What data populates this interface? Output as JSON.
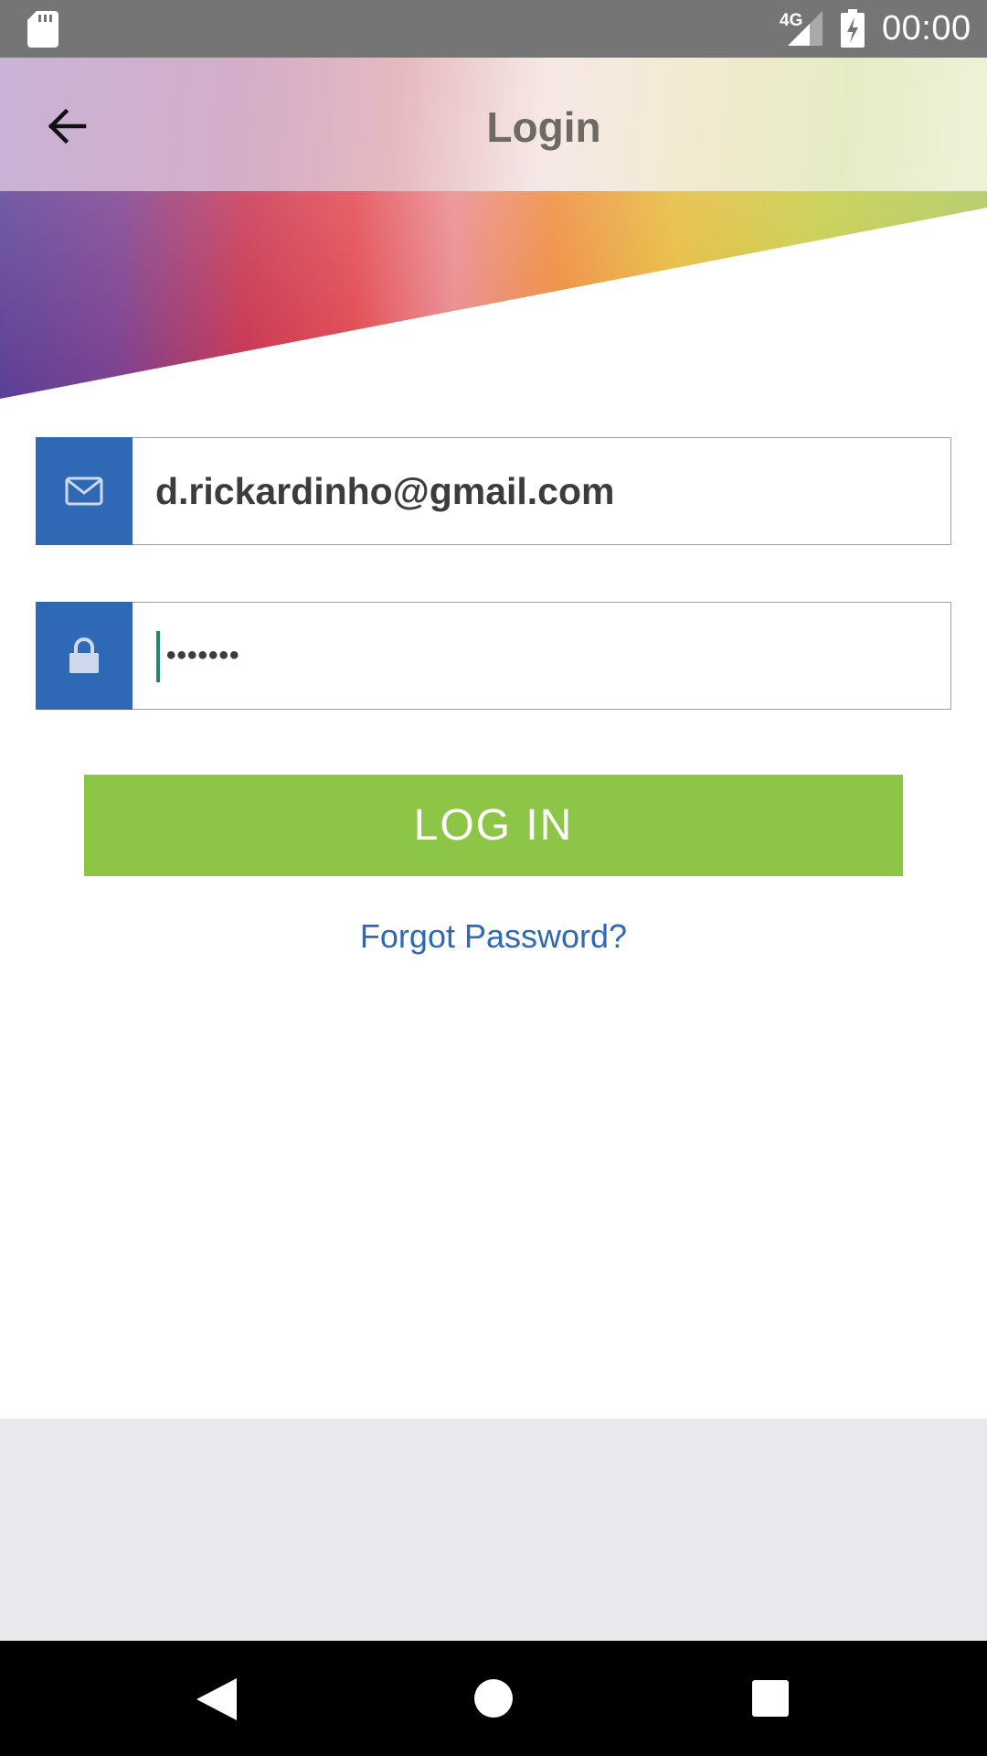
{
  "status_bar": {
    "network_label": "4G",
    "time": "00:00",
    "icons": [
      "sd-card-icon",
      "signal-icon",
      "battery-charging-icon"
    ]
  },
  "header": {
    "title": "Login",
    "back_icon": "arrow-back-icon"
  },
  "form": {
    "email": {
      "icon": "mail-icon",
      "value": "d.rickardinho@gmail.com"
    },
    "password": {
      "icon": "lock-icon",
      "value": "•••••••"
    },
    "login_label": "LOG IN",
    "forgot_label": "Forgot Password?"
  },
  "nav_bar": {
    "icons": [
      "nav-back-icon",
      "nav-home-icon",
      "nav-recents-icon"
    ]
  },
  "colors": {
    "status_bar": "#757575",
    "accent_blue": "#2f69b5",
    "button_green": "#8dc646",
    "title_text": "#6d6a64",
    "footer_bg": "#e9e8ed"
  }
}
